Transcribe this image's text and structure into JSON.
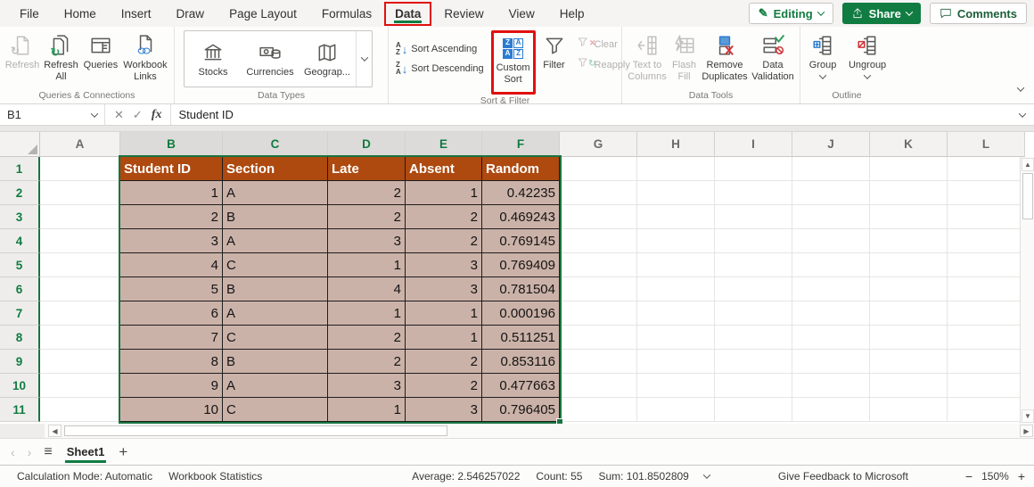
{
  "colors": {
    "excel_green": "#107C41",
    "selection_green": "#1A7340",
    "table_header_fill": "#AE490F",
    "table_cell_fill": "#CBB2A8",
    "highlight_red": "#E01010"
  },
  "tabs": {
    "items": [
      "File",
      "Home",
      "Insert",
      "Draw",
      "Page Layout",
      "Formulas",
      "Data",
      "Review",
      "View",
      "Help"
    ],
    "selected": "Data"
  },
  "top_actions": {
    "editing": "Editing",
    "share": "Share",
    "comments": "Comments"
  },
  "ribbon": {
    "queries_connections": {
      "label": "Queries & Connections",
      "refresh": "Refresh",
      "refresh_all": "Refresh All",
      "queries": "Queries",
      "workbook_links": "Workbook Links"
    },
    "data_types": {
      "label": "Data Types",
      "stocks": "Stocks",
      "currencies": "Currencies",
      "geography": "Geograp..."
    },
    "sort_filter": {
      "label": "Sort & Filter",
      "sort_ascending": "Sort Ascending",
      "sort_descending": "Sort Descending",
      "custom_sort": "Custom Sort",
      "filter": "Filter",
      "clear": "Clear",
      "reapply": "Reapply"
    },
    "data_tools": {
      "label": "Data Tools",
      "text_to_columns": "Text to Columns",
      "flash_fill": "Flash Fill",
      "remove_duplicates": "Remove Duplicates",
      "data_validation": "Data Validation"
    },
    "outline": {
      "label": "Outline",
      "group": "Group",
      "ungroup": "Ungroup"
    }
  },
  "formula_bar": {
    "name_box": "B1",
    "cancel": "✕",
    "enter": "✓",
    "fx": "fx",
    "content": "Student ID"
  },
  "grid": {
    "columns": [
      "A",
      "B",
      "C",
      "D",
      "E",
      "F",
      "G",
      "H",
      "I",
      "J",
      "K",
      "L"
    ],
    "selected_columns": [
      "B",
      "C",
      "D",
      "E",
      "F"
    ],
    "row_numbers": [
      "1",
      "2",
      "3",
      "4",
      "5",
      "6",
      "7",
      "8",
      "9",
      "10",
      "11"
    ],
    "table": {
      "headers": [
        "Student ID",
        "Section",
        "Late",
        "Absent",
        "Random"
      ],
      "rows": [
        [
          "1",
          "A",
          "2",
          "1",
          "0.42235"
        ],
        [
          "2",
          "B",
          "2",
          "2",
          "0.469243"
        ],
        [
          "3",
          "A",
          "3",
          "2",
          "0.769145"
        ],
        [
          "4",
          "C",
          "1",
          "3",
          "0.769409"
        ],
        [
          "5",
          "B",
          "4",
          "3",
          "0.781504"
        ],
        [
          "6",
          "A",
          "1",
          "1",
          "0.000196"
        ],
        [
          "7",
          "C",
          "2",
          "1",
          "0.511251"
        ],
        [
          "8",
          "B",
          "2",
          "2",
          "0.853116"
        ],
        [
          "9",
          "A",
          "3",
          "2",
          "0.477663"
        ],
        [
          "10",
          "C",
          "1",
          "3",
          "0.796405"
        ]
      ]
    }
  },
  "sheet_bar": {
    "sheet_name": "Sheet1",
    "add_sheet": "+"
  },
  "status_bar": {
    "calculation_mode": "Calculation Mode: Automatic",
    "workbook_statistics": "Workbook Statistics",
    "average": "Average: 2.546257022",
    "count": "Count: 55",
    "sum": "Sum: 101.8502809",
    "feedback": "Give Feedback to Microsoft",
    "zoom_out": "−",
    "zoom_level": "150%",
    "zoom_in": "+"
  }
}
